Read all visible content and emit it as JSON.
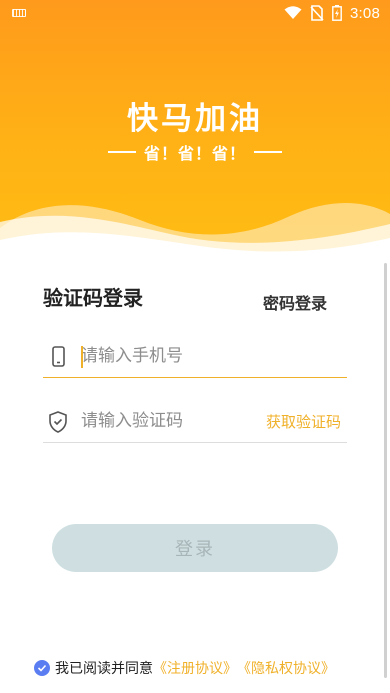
{
  "status_bar": {
    "time": "3:08",
    "icons": [
      "keyboard-icon",
      "wifi-icon",
      "no-sim-icon",
      "battery-charging-icon"
    ]
  },
  "header": {
    "title": "快马加油",
    "slogan": "省！省！省！",
    "colors": {
      "gradient_top": "#ff9a1c",
      "gradient_bottom": "#ffbd14"
    }
  },
  "tabs": {
    "sms_login": "验证码登录",
    "password_login": "密码登录"
  },
  "phone_field": {
    "placeholder": "请输入手机号",
    "value": "",
    "icon": "phone-icon"
  },
  "code_field": {
    "placeholder": "请输入验证码",
    "value": "",
    "icon": "shield-icon",
    "get_code_label": "获取验证码"
  },
  "login_button": {
    "label": "登录",
    "enabled": false
  },
  "agreement": {
    "checked": true,
    "text": "我已阅读并同意",
    "register_link": "《注册协议》",
    "privacy_link": "《隐私权协议》"
  },
  "accent_color": "#f0b12a"
}
